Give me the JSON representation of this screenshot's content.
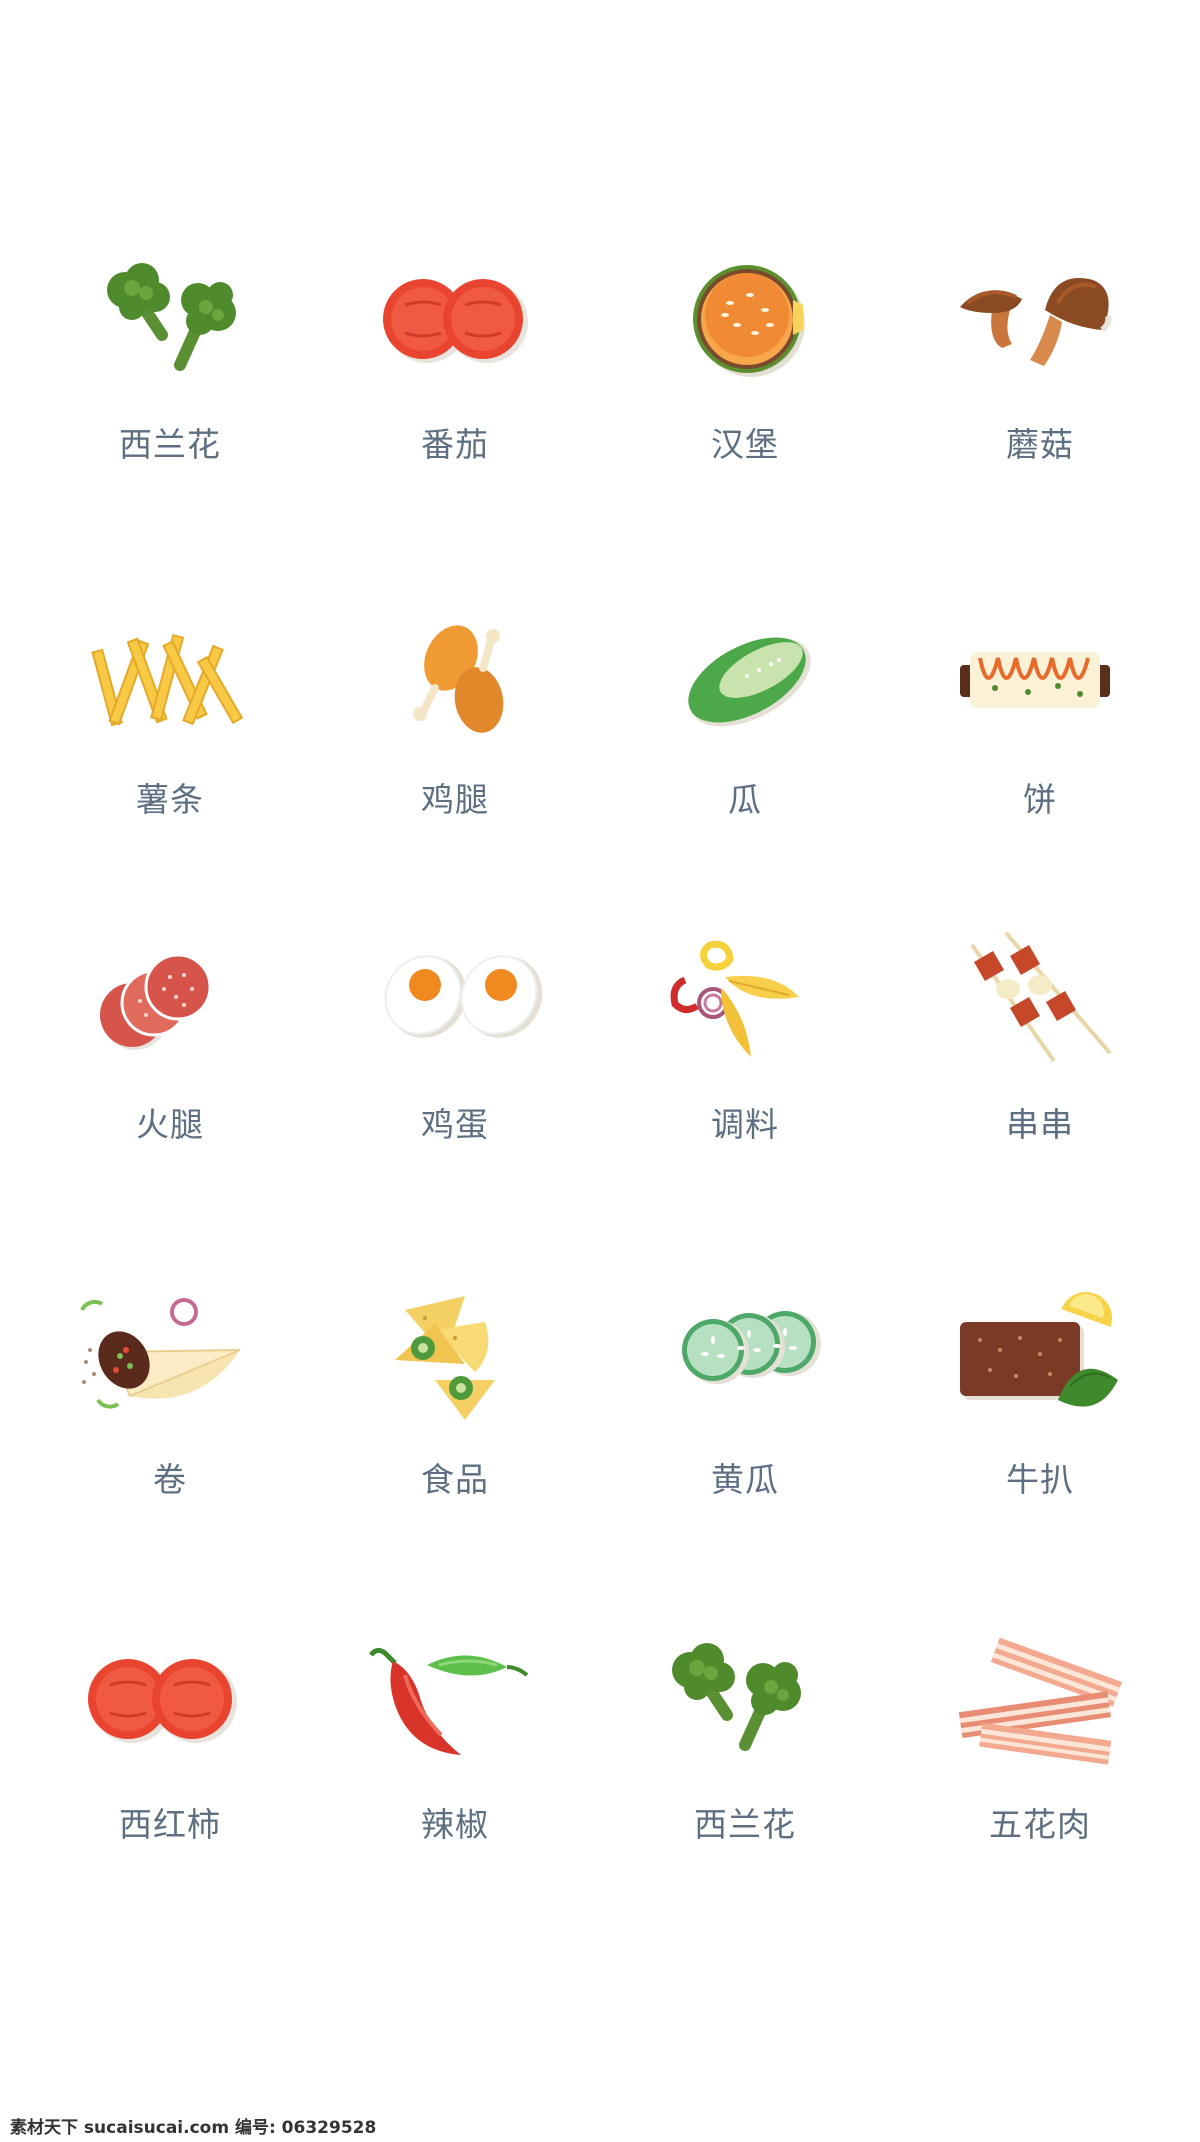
{
  "items": [
    {
      "label": "西兰花",
      "icon": "broccoli-icon"
    },
    {
      "label": "番茄",
      "icon": "tomato-icon"
    },
    {
      "label": "汉堡",
      "icon": "burger-icon"
    },
    {
      "label": "蘑菇",
      "icon": "mushroom-icon"
    },
    {
      "label": "薯条",
      "icon": "fries-icon"
    },
    {
      "label": "鸡腿",
      "icon": "drumstick-icon"
    },
    {
      "label": "瓜",
      "icon": "melon-icon"
    },
    {
      "label": "饼",
      "icon": "pancake-roll-icon"
    },
    {
      "label": "火腿",
      "icon": "ham-slices-icon"
    },
    {
      "label": "鸡蛋",
      "icon": "egg-icon"
    },
    {
      "label": "调料",
      "icon": "seasoning-icon"
    },
    {
      "label": "串串",
      "icon": "skewer-icon"
    },
    {
      "label": "卷",
      "icon": "wrap-icon"
    },
    {
      "label": "食品",
      "icon": "tortilla-chips-icon"
    },
    {
      "label": "黄瓜",
      "icon": "cucumber-slices-icon"
    },
    {
      "label": "牛扒",
      "icon": "steak-icon"
    },
    {
      "label": "西红柿",
      "icon": "tomato-icon"
    },
    {
      "label": "辣椒",
      "icon": "chili-pepper-icon"
    },
    {
      "label": "西兰花",
      "icon": "broccoli-icon"
    },
    {
      "label": "五花肉",
      "icon": "bacon-icon"
    }
  ],
  "watermark": "素材天下 sucaisucai.com  编号: 06329528"
}
